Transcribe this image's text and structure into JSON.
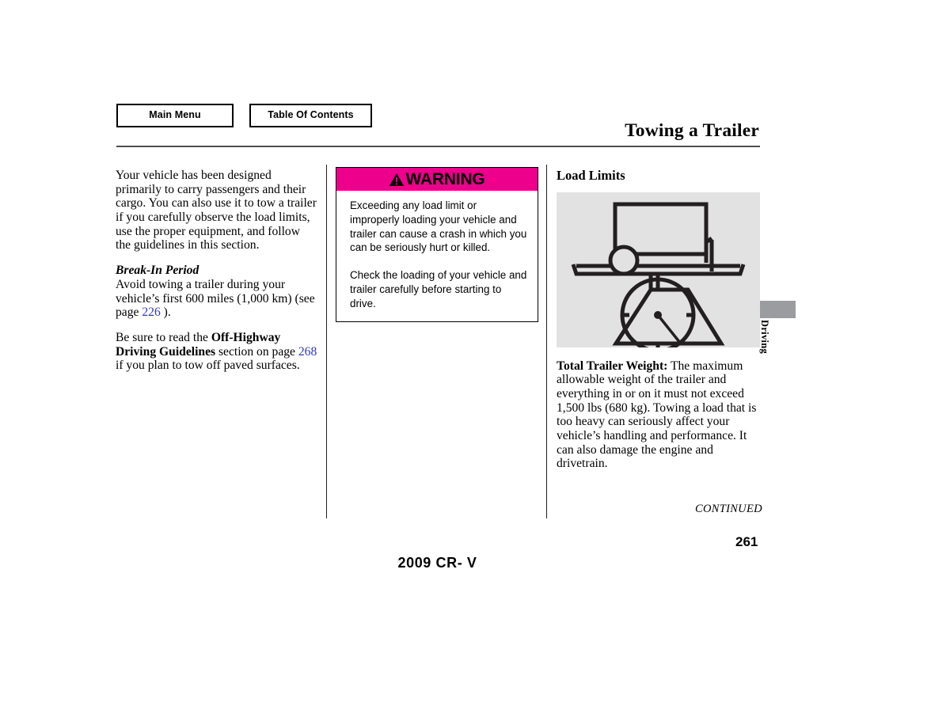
{
  "nav": {
    "main_menu_label": "Main Menu",
    "table_of_contents_label": "Table Of Contents"
  },
  "header": {
    "title": "Towing a Trailer"
  },
  "left_column": {
    "intro": "Your vehicle has been designed primarily to carry passengers and their cargo. You can also use it to tow a trailer if you carefully observe the load limits, use the proper equipment, and follow the guidelines in this section.",
    "break_in_heading": "Break-In Period",
    "break_in_text_1": "Avoid towing a trailer during your vehicle’s first 600 miles (1,000 km) (see page ",
    "break_in_page_ref": "226",
    "break_in_text_2": " ).",
    "offhighway_text_1": "Be sure to read the ",
    "offhighway_bold": "Off-Highway Driving Guidelines",
    "offhighway_text_2": " section on page ",
    "offhighway_page_ref": "268",
    "offhighway_text_3": " if you plan to tow off paved surfaces."
  },
  "warning": {
    "heading": "WARNING",
    "icon": "warning-triangle-icon",
    "header_color": "#ec008c",
    "paragraph_1": "Exceeding any load limit or improperly loading your vehicle and trailer can cause a crash in which you can be seriously hurt or killed.",
    "paragraph_2": "Check the loading of your vehicle and trailer carefully before starting to drive."
  },
  "right_column": {
    "section_heading": "Load Limits",
    "figure_alt": "trailer-on-weighing-scale-illustration",
    "figure_background": "#e2e2e2",
    "total_trailer_weight_label": "Total Trailer Weight:",
    "total_trailer_weight_text": " The maximum allowable weight of the trailer and everything in or on it must not exceed 1,500 lbs (680 kg). Towing a load that is too heavy can seriously affect your vehicle’s handling and performance. It can also damage the engine and drivetrain."
  },
  "footer": {
    "continued": "CONTINUED",
    "page_number": "261",
    "model": "2009  CR- V"
  },
  "thumb_tab": {
    "label": "Driving",
    "color": "#9a9ca0"
  }
}
